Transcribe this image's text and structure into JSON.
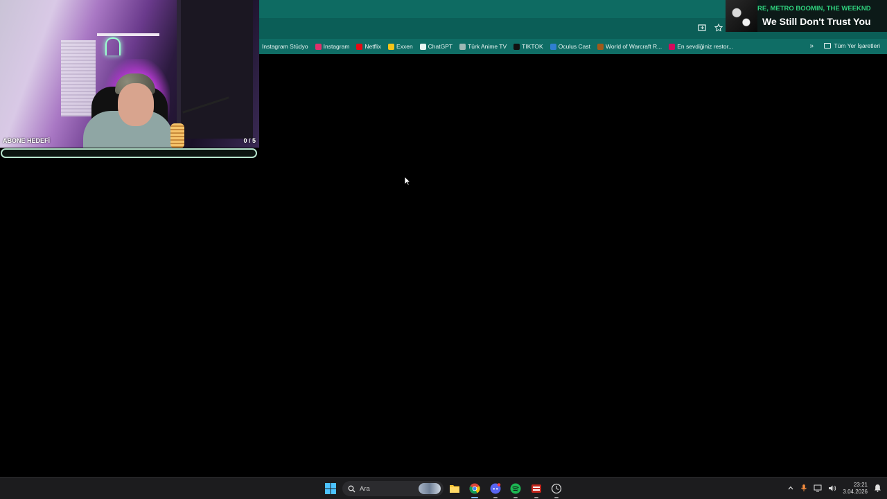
{
  "bookmarks": [
    {
      "label": "Instagram Stüdyo",
      "icon": "instagram-studio-icon",
      "color": "#0f6d65"
    },
    {
      "label": "Instagram",
      "icon": "instagram-icon",
      "color": "#e1306c"
    },
    {
      "label": "Netflix",
      "icon": "netflix-icon",
      "color": "#e50914"
    },
    {
      "label": "Exxen",
      "icon": "exxen-icon",
      "color": "#f5c518"
    },
    {
      "label": "ChatGPT",
      "icon": "chatgpt-icon",
      "color": "#e8f4f2"
    },
    {
      "label": "Türk Anime TV",
      "icon": "turk-anime-icon",
      "color": "#9fb8b5"
    },
    {
      "label": "TIKTOK",
      "icon": "tiktok-icon",
      "color": "#111111"
    },
    {
      "label": "Oculus Cast",
      "icon": "oculus-icon",
      "color": "#2f7fd1"
    },
    {
      "label": "World of Warcraft R...",
      "icon": "wow-icon",
      "color": "#a05a1a"
    },
    {
      "label": "En sevdiğiniz restor...",
      "icon": "yemeksepeti-icon",
      "color": "#d40a5c"
    }
  ],
  "bookmarks_overflow": "»",
  "all_bookmarks_label": "Tüm Yer İşaretleri",
  "stream": {
    "goal_label": "ABONE HEDEFİ",
    "goal_count": "0 / 5",
    "goal_progress": 0
  },
  "now_playing": {
    "artist": "RE, METRO BOOMIN, THE WEEKND",
    "title": "We Still Don't Trust You"
  },
  "taskbar": {
    "search_placeholder": "Ara",
    "apps": [
      "file-explorer",
      "chrome",
      "discord",
      "spotify",
      "voice-app",
      "clock-app"
    ],
    "time": "23:21",
    "date": "3.04.2026"
  },
  "colors": {
    "browser_teal": "#0e6b62",
    "goal_green": "#3fd38a",
    "now_playing_artist": "#2fd27e"
  }
}
